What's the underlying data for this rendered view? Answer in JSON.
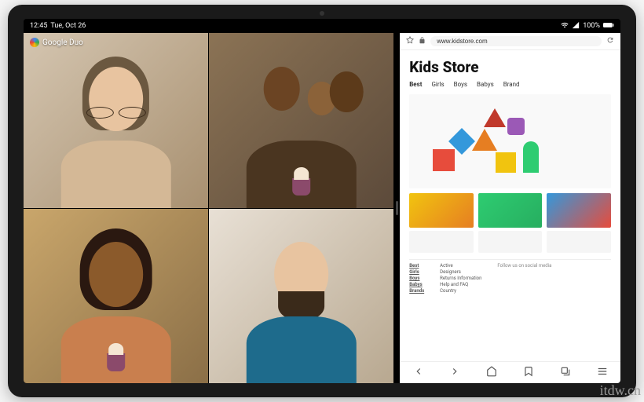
{
  "statusbar": {
    "time": "12:45",
    "date": "Tue, Oct 26",
    "battery_pct": "100%"
  },
  "video_app": {
    "label": "Google Duo"
  },
  "browser": {
    "url": "www.kidstore.com",
    "site_title": "Kids Store",
    "tabs": [
      "Best",
      "Girls",
      "Boys",
      "Babys",
      "Brand"
    ],
    "footer_col1": [
      "Best",
      "Girls",
      "Boys",
      "Babys",
      "Brands"
    ],
    "footer_col2": [
      "Active",
      "Designers",
      "Returns Information",
      "Help and FAQ",
      "Country"
    ],
    "social_label": "Follow us on social media"
  },
  "watermark": "itdw.cn"
}
